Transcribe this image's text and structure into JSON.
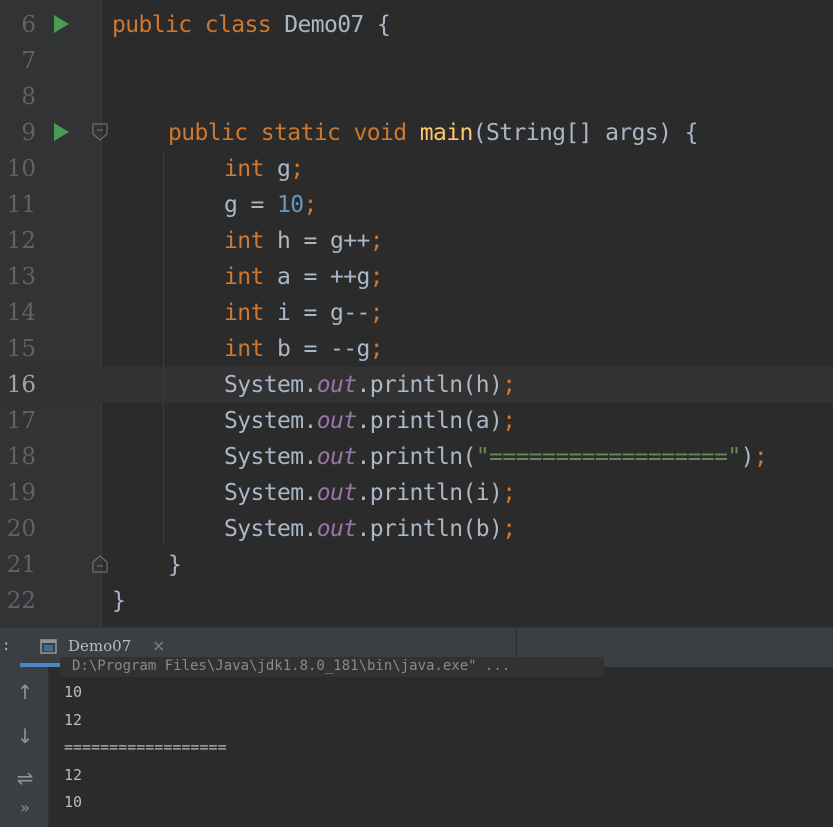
{
  "editor": {
    "lines": [
      {
        "num": "6",
        "tokens": [
          {
            "t": "public class ",
            "c": "kw"
          },
          {
            "t": "Demo07 {",
            "c": ""
          }
        ],
        "indent": 0,
        "run": true
      },
      {
        "num": "7",
        "tokens": [],
        "indent": 0
      },
      {
        "num": "8",
        "tokens": [],
        "indent": 0
      },
      {
        "num": "9",
        "tokens": [
          {
            "t": "public static void ",
            "c": "kw"
          },
          {
            "t": "main",
            "c": "fn"
          },
          {
            "t": "(String[] args) {",
            "c": ""
          }
        ],
        "indent": 1,
        "run": true,
        "fold": "open"
      },
      {
        "num": "10",
        "tokens": [
          {
            "t": "int ",
            "c": "kw"
          },
          {
            "t": "g",
            "c": ""
          },
          {
            "t": ";",
            "c": "kw"
          }
        ],
        "indent": 2
      },
      {
        "num": "11",
        "tokens": [
          {
            "t": "g = ",
            "c": ""
          },
          {
            "t": "10",
            "c": "num"
          },
          {
            "t": ";",
            "c": "kw"
          }
        ],
        "indent": 2
      },
      {
        "num": "12",
        "tokens": [
          {
            "t": "int ",
            "c": "kw"
          },
          {
            "t": "h = g++",
            "c": ""
          },
          {
            "t": ";",
            "c": "kw"
          }
        ],
        "indent": 2
      },
      {
        "num": "13",
        "tokens": [
          {
            "t": "int ",
            "c": "kw"
          },
          {
            "t": "a = ++g",
            "c": ""
          },
          {
            "t": ";",
            "c": "kw"
          }
        ],
        "indent": 2
      },
      {
        "num": "14",
        "tokens": [
          {
            "t": "int ",
            "c": "kw"
          },
          {
            "t": "i = g--",
            "c": ""
          },
          {
            "t": ";",
            "c": "kw"
          }
        ],
        "indent": 2
      },
      {
        "num": "15",
        "tokens": [
          {
            "t": "int ",
            "c": "kw"
          },
          {
            "t": "b = --g",
            "c": ""
          },
          {
            "t": ";",
            "c": "kw"
          }
        ],
        "indent": 2
      },
      {
        "num": "16",
        "tokens": [
          {
            "t": "System.",
            "c": ""
          },
          {
            "t": "out",
            "c": "fld"
          },
          {
            "t": ".println(h)",
            "c": ""
          },
          {
            "t": ";",
            "c": "kw"
          }
        ],
        "indent": 2,
        "current": true
      },
      {
        "num": "17",
        "tokens": [
          {
            "t": "System.",
            "c": ""
          },
          {
            "t": "out",
            "c": "fld"
          },
          {
            "t": ".println(a)",
            "c": ""
          },
          {
            "t": ";",
            "c": "kw"
          }
        ],
        "indent": 2
      },
      {
        "num": "18",
        "tokens": [
          {
            "t": "System.",
            "c": ""
          },
          {
            "t": "out",
            "c": "fld"
          },
          {
            "t": ".println(",
            "c": ""
          },
          {
            "t": "\"==================\"",
            "c": "str"
          },
          {
            "t": ")",
            "c": ""
          },
          {
            "t": ";",
            "c": "kw"
          }
        ],
        "indent": 2
      },
      {
        "num": "19",
        "tokens": [
          {
            "t": "System.",
            "c": ""
          },
          {
            "t": "out",
            "c": "fld"
          },
          {
            "t": ".println(i)",
            "c": ""
          },
          {
            "t": ";",
            "c": "kw"
          }
        ],
        "indent": 2
      },
      {
        "num": "20",
        "tokens": [
          {
            "t": "System.",
            "c": ""
          },
          {
            "t": "out",
            "c": "fld"
          },
          {
            "t": ".println(b)",
            "c": ""
          },
          {
            "t": ";",
            "c": "kw"
          }
        ],
        "indent": 2
      },
      {
        "num": "21",
        "tokens": [
          {
            "t": "}",
            "c": ""
          }
        ],
        "indent": 1,
        "fold": "close"
      },
      {
        "num": "22",
        "tokens": [
          {
            "t": "}",
            "c": ""
          }
        ],
        "indent": 0
      }
    ]
  },
  "run_panel": {
    "colon": ":",
    "tab_label": "Demo07",
    "tab_close": "×",
    "command_line": "D:\\Program Files\\Java\\jdk1.8.0_181\\bin\\java.exe\" ...",
    "output": [
      "10",
      "12",
      "==================",
      "12",
      "10"
    ],
    "tools": [
      {
        "name": "arrow-up-icon",
        "glyph": "↑"
      },
      {
        "name": "arrow-down-icon",
        "glyph": "↓"
      },
      {
        "name": "soft-wrap-icon",
        "glyph": "⇌"
      },
      {
        "name": "more-tools-icon",
        "glyph": "»"
      }
    ]
  },
  "colors": {
    "keyword": "#cc7832",
    "function": "#ffc66d",
    "number": "#6897bb",
    "field": "#9876aa",
    "string": "#6a8759",
    "text": "#a9b7c6",
    "run_gutter": "#499c54",
    "tab_accent": "#4a88c7"
  }
}
